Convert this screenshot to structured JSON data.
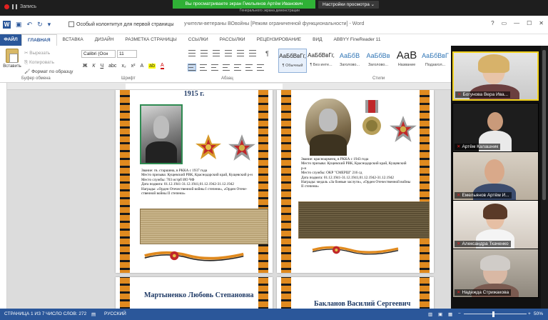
{
  "zoom": {
    "recording_label": "Запись",
    "viewing_banner": "Вы просматриваете экран Гмельянов Артём Иванович",
    "banner_sub": "Генерального экрана демонстрации",
    "view_options": "Настройки просмотра"
  },
  "word": {
    "checkbox_label": "Особый колонтитул для первой страницы",
    "doc_title": "учители-ветераны ВОвойны [Режим ограниченной функциональности] - Word",
    "help": "?",
    "login": "Вход",
    "tabs": [
      "ФАЙЛ",
      "ГЛАВНАЯ",
      "ВСТАВКА",
      "ДИЗАЙН",
      "РАЗМЕТКА СТРАНИЦЫ",
      "ССЫЛКИ",
      "РАССЫЛКИ",
      "РЕЦЕНЗИРОВАНИЕ",
      "ВИД",
      "ABBYY FineReader 11"
    ],
    "paste_label": "Вставить",
    "clipboard": [
      "Вырезать",
      "Копировать",
      "Формат по образцу"
    ],
    "font_name": "Calibri (Осн",
    "font_size": "11",
    "group_labels": {
      "clipboard": "Буфер обмена",
      "font": "Шрифт",
      "paragraph": "Абзац",
      "styles": "Стили"
    },
    "styles": [
      {
        "sample": "АаБбВвГг,",
        "name": "¶ Обычный",
        "kind": "normal",
        "selected": true
      },
      {
        "sample": "АаБбВвГг,",
        "name": "¶ Без инте...",
        "kind": "normal"
      },
      {
        "sample": "АаБбВ",
        "name": "Заголово...",
        "kind": "heading"
      },
      {
        "sample": "АаБбВв",
        "name": "Заголово...",
        "kind": "heading"
      },
      {
        "sample": "АаВ",
        "name": "Название",
        "kind": "big"
      },
      {
        "sample": "АаБбВвГ",
        "name": "Подзагол...",
        "kind": "heading"
      }
    ]
  },
  "doc": {
    "page1": {
      "header_text": "1915 г.",
      "lines": [
        "Звание: гв. старшина, в РККА с 1937 года",
        "Место призыва: Кущевский РВК, Краснодарский край, Кущевский р-н",
        "Место службы: 703 истрб ИО ЧФ",
        "Дата подвига: 01.12.1941-31.12.1941,01.12.1942-31.12.1942",
        "Награды: «Орден Отечественной войны I степени», «Орден Отече-",
        "ственной войны II степени»"
      ]
    },
    "page2": {
      "lines": [
        "Звание: красноармеец, в РККА с 1943 года",
        "Место призыва: Кущевский РВК, Краснодарский край, Кущевский",
        "р-н",
        "Место службы: ОКР \"СМЕРШ\" 216 сд",
        "Дата подвига: 01.12.1941-31.12.1941,01.12.1942-31.12.1942",
        "Награды: медаль «За боевые заслуги», «Орден Отечественной войны",
        "II степени»"
      ]
    },
    "page3": {
      "name": "Мартыненко Любовь Степановна"
    },
    "page4": {
      "name": "Бакланов Василий Сергеевич"
    }
  },
  "participants": [
    {
      "name": "Богунова Вера Ива..."
    },
    {
      "name": "Артём Калашник"
    },
    {
      "name": "Емельянов Артём И..."
    },
    {
      "name": "Александра Ткаченко"
    },
    {
      "name": "Надежда Стрижакова"
    }
  ],
  "status": {
    "page": "СТРАНИЦА 1 ИЗ 7",
    "words": "ЧИСЛО СЛОВ: 272",
    "lang": "РУССКИЙ",
    "zoom": "50%"
  }
}
